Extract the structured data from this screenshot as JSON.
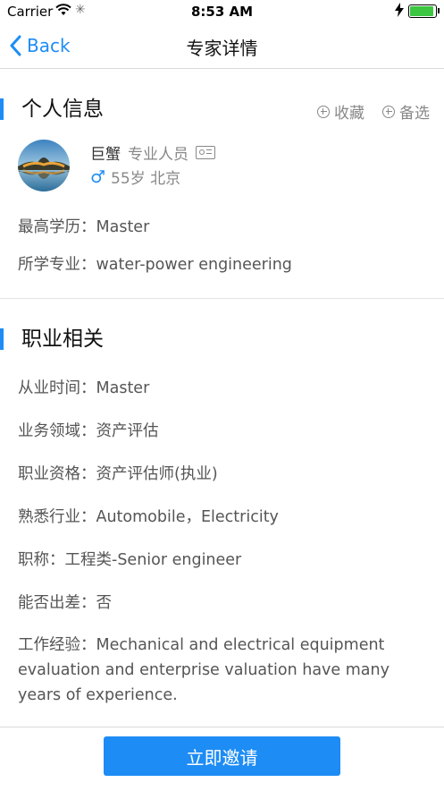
{
  "status": {
    "carrier": "Carrier",
    "time": "8:53 AM"
  },
  "nav": {
    "back_label": "Back",
    "title": "专家详情"
  },
  "personal": {
    "section_title": "个人信息",
    "collect_label": "收藏",
    "candidate_label": "备选",
    "name": "巨蟹",
    "role": "专业人员",
    "gender_symbol": "♂",
    "age_city": "55岁 北京",
    "education": "最高学历：Master",
    "major": "所学专业：water-power engineering"
  },
  "career": {
    "section_title": "职业相关",
    "years": "从业时间：Master",
    "business": "业务领域：资产评估",
    "qualification": "职业资格：资产评估师(执业)",
    "industry": "熟悉行业：Automobile，Electricity",
    "job_title": "职称：工程类-Senior engineer",
    "travel": "能否出差：否",
    "experience": "工作经验：Mechanical and electrical equipment evaluation and enterprise valuation have many years of experience."
  },
  "footer": {
    "invite_label": "立即邀请"
  },
  "colors": {
    "accent": "#1d8cf5",
    "battery": "#3cc642"
  }
}
